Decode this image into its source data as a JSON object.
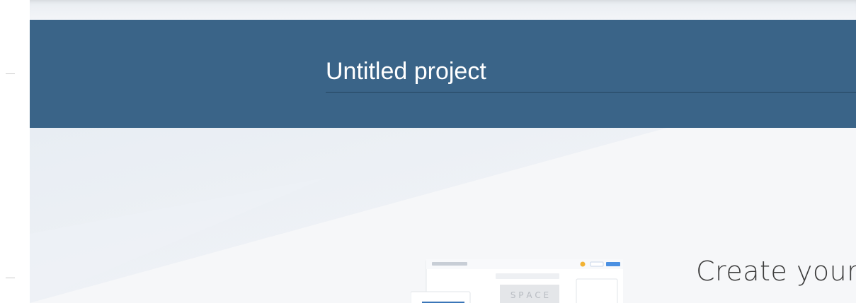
{
  "project": {
    "title": "Untitled project"
  },
  "hero": {
    "heading": "Create your",
    "preview_caption": "S P A C E"
  },
  "colors": {
    "header_band": "#3a6488",
    "title_text": "#ffffff",
    "title_underline": "#24455f",
    "main_background": "#f6f7f9",
    "heading_text": "#3c3c3c"
  }
}
